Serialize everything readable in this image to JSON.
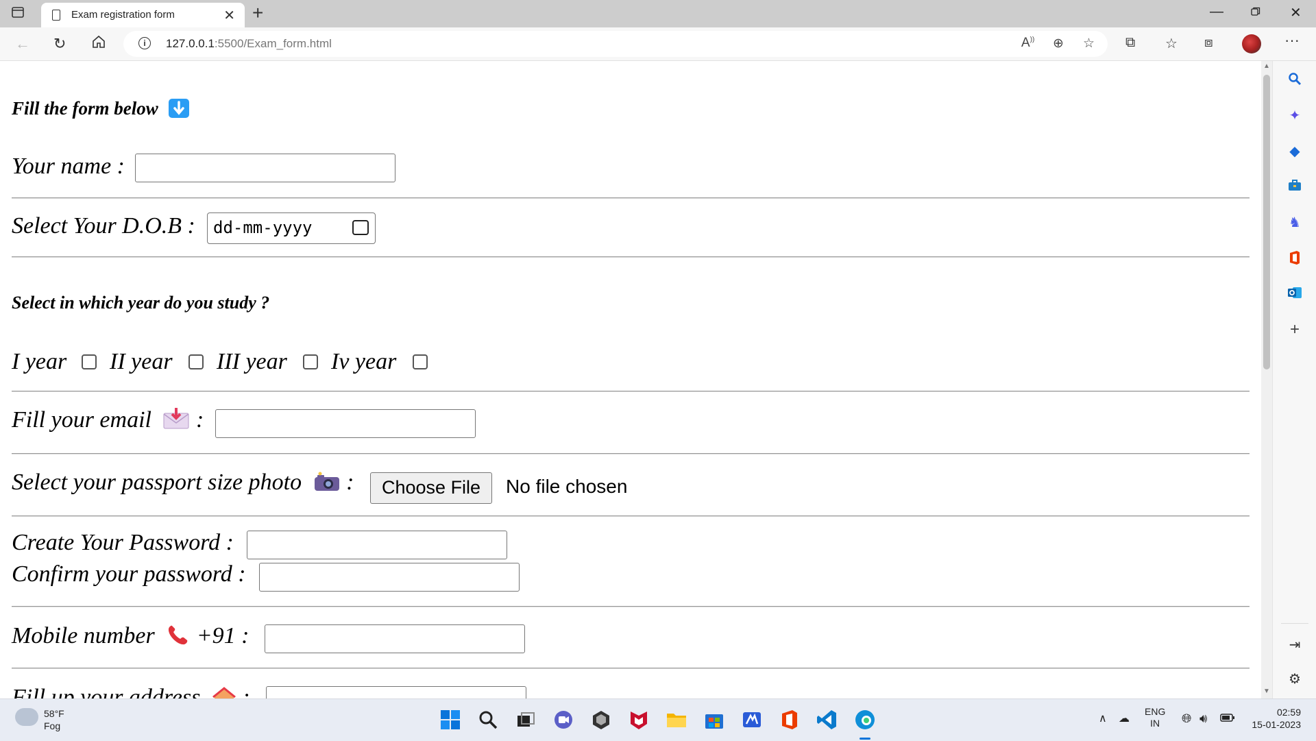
{
  "browser": {
    "tab_title": "Exam registration form",
    "url_host": "127.0.0.1",
    "url_rest": ":5500/Exam_form.html"
  },
  "form": {
    "heading": "Fill the form below",
    "name_label": "Your name :",
    "dob_label": "Select Your D.O.B :",
    "dob_placeholder": "dd-mm-yyyy",
    "year_question": "Select in which year do you study ?",
    "years": [
      "I year",
      "II year",
      "III year",
      "Iv year"
    ],
    "email_label": "Fill your email",
    "colon": ":",
    "photo_label": "Select your passport size photo",
    "file_button": "Choose File",
    "file_status": "No file chosen",
    "password_label": "Create Your Password :",
    "confirm_label": "Confirm your password :",
    "mobile_label": "Mobile number",
    "mobile_code": "+91 :",
    "address_label": "Fill up your address"
  },
  "taskbar": {
    "temp": "58°F",
    "condition": "Fog",
    "lang1": "ENG",
    "lang2": "IN",
    "time": "02:59",
    "date": "15-01-2023"
  },
  "icons": {
    "heading_emoji": "down-arrow-icon",
    "email_emoji": "envelope-icon",
    "photo_emoji": "camera-icon",
    "mobile_emoji": "phone-icon",
    "address_emoji": "house-icon"
  }
}
